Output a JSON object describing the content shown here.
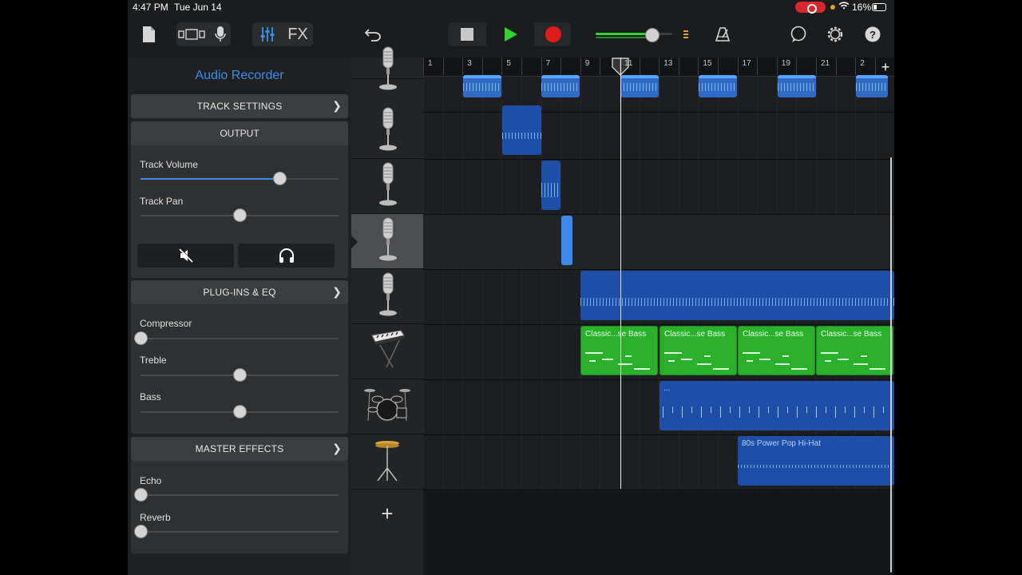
{
  "status": {
    "time": "4:47 PM",
    "date": "Tue Jun 14",
    "battery": "16%"
  },
  "toolbar": {
    "fx_label": "FX",
    "icons": [
      "browser-icon",
      "track-view-icon",
      "microphone-icon",
      "mixer-controls-icon",
      "fx-icon",
      "undo-icon",
      "stop-icon",
      "play-icon",
      "record-icon",
      "master-volume-slider",
      "metronome-icon",
      "loop-browser-icon",
      "settings-icon",
      "help-icon"
    ],
    "master_volume": 0.72
  },
  "inspector": {
    "title": "Audio Recorder",
    "track_settings": "TRACK SETTINGS",
    "output": {
      "header": "OUTPUT",
      "volume_label": "Track Volume",
      "volume_value": 0.7,
      "pan_label": "Track Pan",
      "pan_value": 0.5,
      "mute_icon": "speaker-mute-icon",
      "solo_icon": "headphones-icon"
    },
    "plugins": {
      "header": "PLUG-INS & EQ",
      "compressor_label": "Compressor",
      "compressor_value": 0.0,
      "treble_label": "Treble",
      "treble_value": 0.5,
      "bass_label": "Bass",
      "bass_value": 0.5
    },
    "master_effects": {
      "header": "MASTER EFFECTS",
      "echo_label": "Echo",
      "echo_value": 0.0,
      "reverb_label": "Reverb",
      "reverb_value": 0.0
    }
  },
  "tracks": [
    {
      "icon": "microphone-icon",
      "selected": false
    },
    {
      "icon": "microphone-icon",
      "selected": false
    },
    {
      "icon": "microphone-icon",
      "selected": false
    },
    {
      "icon": "microphone-icon",
      "selected": true
    },
    {
      "icon": "microphone-icon",
      "selected": false
    },
    {
      "icon": "keyboard-icon",
      "selected": false
    },
    {
      "icon": "drum-kit-icon",
      "selected": false
    },
    {
      "icon": "hi-hat-icon",
      "selected": false
    }
  ],
  "ruler": {
    "bars": [
      "1",
      "3",
      "5",
      "7",
      "9",
      "11",
      "13",
      "15",
      "17",
      "19",
      "21",
      "2"
    ]
  },
  "regions": {
    "bass_name": "Classic...se Bass",
    "drum_name": "...",
    "hihat_name": "80s Power Pop Hi-Hat"
  }
}
